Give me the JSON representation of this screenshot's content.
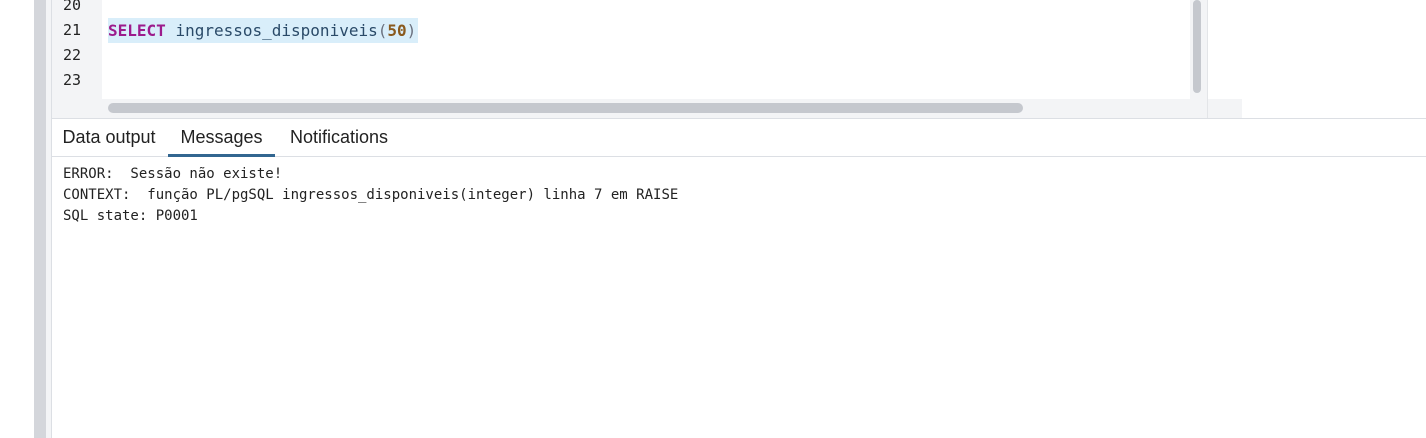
{
  "editor": {
    "line_numbers": [
      "20",
      "21",
      "22",
      "23"
    ],
    "code": {
      "keyword": "SELECT",
      "function": "ingressos_disponiveis",
      "open_paren": "(",
      "argument": "50",
      "close_paren": ")"
    }
  },
  "tabs": [
    {
      "label": "Data output",
      "active": false
    },
    {
      "label": "Messages",
      "active": true
    },
    {
      "label": "Notifications",
      "active": false
    }
  ],
  "messages": {
    "lines": [
      "ERROR:  Sessão não existe!",
      "CONTEXT:  função PL/pgSQL ingressos_disponiveis(integer) linha 7 em RAISE",
      "SQL state: P0001"
    ]
  },
  "colors": {
    "keyword": "#9c1b8c",
    "number": "#8a5a1e",
    "active_tab_underline": "#326690",
    "selection": "#d9eefa"
  }
}
